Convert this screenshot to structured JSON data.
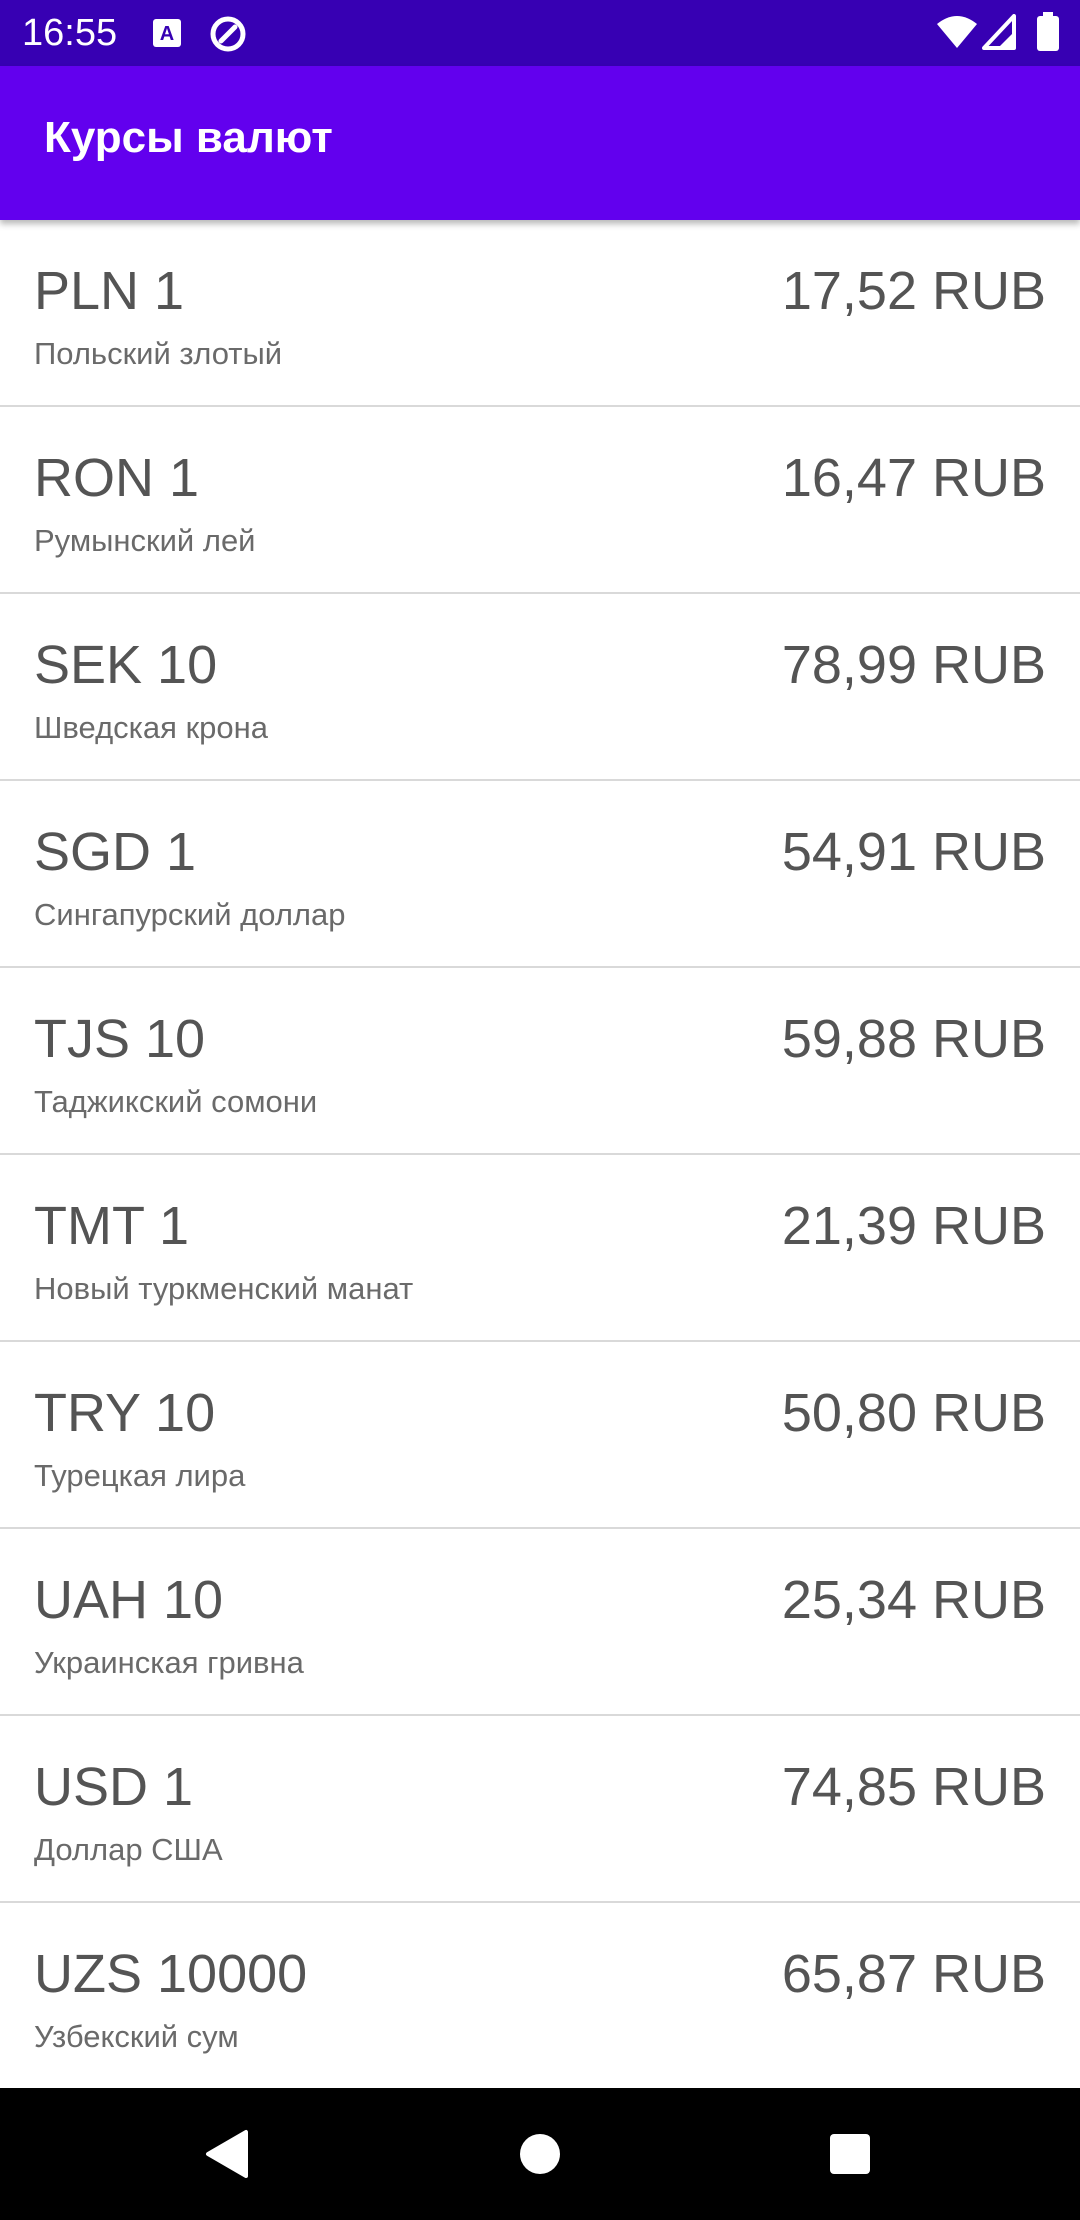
{
  "status_bar": {
    "time": "16:55",
    "icons": [
      "accessibility-a-icon",
      "data-saver-icon",
      "wifi-icon",
      "signal-icon",
      "battery-icon"
    ]
  },
  "app_bar": {
    "title": "Курсы валют"
  },
  "colors": {
    "status_bar": "#3700b3",
    "primary": "#6200ee",
    "text_primary": "#545454",
    "text_secondary": "#6a6a6a",
    "divider": "#d9d9d9"
  },
  "rates": [
    {
      "code": "PLN 1",
      "name": "Польский злотый",
      "value": "17,52 RUB"
    },
    {
      "code": "RON 1",
      "name": "Румынский лей",
      "value": "16,47 RUB"
    },
    {
      "code": "SEK 10",
      "name": "Шведская крона",
      "value": "78,99 RUB"
    },
    {
      "code": "SGD 1",
      "name": "Сингапурский доллар",
      "value": "54,91 RUB"
    },
    {
      "code": "TJS 10",
      "name": "Таджикский сомони",
      "value": "59,88 RUB"
    },
    {
      "code": "TMT 1",
      "name": "Новый туркменский манат",
      "value": "21,39 RUB"
    },
    {
      "code": "TRY 10",
      "name": "Турецкая лира",
      "value": "50,80 RUB"
    },
    {
      "code": "UAH 10",
      "name": "Украинская гривна",
      "value": "25,34 RUB"
    },
    {
      "code": "USD 1",
      "name": "Доллар США",
      "value": "74,85 RUB"
    },
    {
      "code": "UZS 10000",
      "name": "Узбекский сум",
      "value": "65,87 RUB"
    }
  ],
  "nav_bar": {
    "buttons": [
      "back-icon",
      "home-icon",
      "recents-icon"
    ]
  }
}
